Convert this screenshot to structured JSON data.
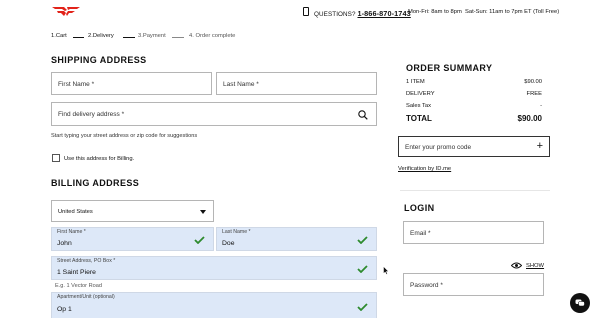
{
  "header": {
    "logo_icon": "reebok-delta-logo",
    "phone_icon": "phone-icon",
    "questions_label": "QUESTIONS?",
    "phone_number": "1-866-870-1743",
    "hours_weekday": "Mon-Fri: 8am to 8pm",
    "hours_weekend": "Sat-Sun: 11am to 7pm ET (Toll Free)"
  },
  "steps": [
    {
      "label": "1.Cart"
    },
    {
      "label": "2.Delivery"
    },
    {
      "label": "3.Payment"
    },
    {
      "label": "4. Order complete"
    }
  ],
  "shipping": {
    "title": "SHIPPING ADDRESS",
    "first_name_ph": "First Name *",
    "last_name_ph": "Last Name *",
    "find_address_ph": "Find delivery address *",
    "hint": "Start typing your street address or zip code for suggestions",
    "use_for_billing": "Use this address for Billing."
  },
  "billing": {
    "title": "BILLING ADDRESS",
    "country": "United States",
    "first_name_label": "First Name *",
    "first_name_value": "John",
    "last_name_label": "Last Name *",
    "last_name_value": "Doe",
    "street_label": "Street Address, PO Box *",
    "street_value": "1 Saint Piere",
    "street_hint": "E.g. 1 Vector Road",
    "apt_label": "Apartment/Unit (optional)",
    "apt_value": "Op 1"
  },
  "summary": {
    "title": "ORDER SUMMARY",
    "items_label": "1 ITEM",
    "items_value": "$90.00",
    "delivery_label": "DELIVERY",
    "delivery_value": "FREE",
    "tax_label": "Sales Tax",
    "tax_value": "-",
    "total_label": "TOTAL",
    "total_value": "$90.00",
    "promo_ph": "Enter your promo code",
    "promo_plus": "+",
    "verification": "Verification by ID.me"
  },
  "login": {
    "title": "LOGIN",
    "email_ph": "Email *",
    "password_ph": "Password *",
    "show": "SHOW"
  },
  "colors": {
    "filled_bg": "#dde8f8",
    "check_green": "#2e8b2e",
    "logo_red": "#e2231a"
  }
}
